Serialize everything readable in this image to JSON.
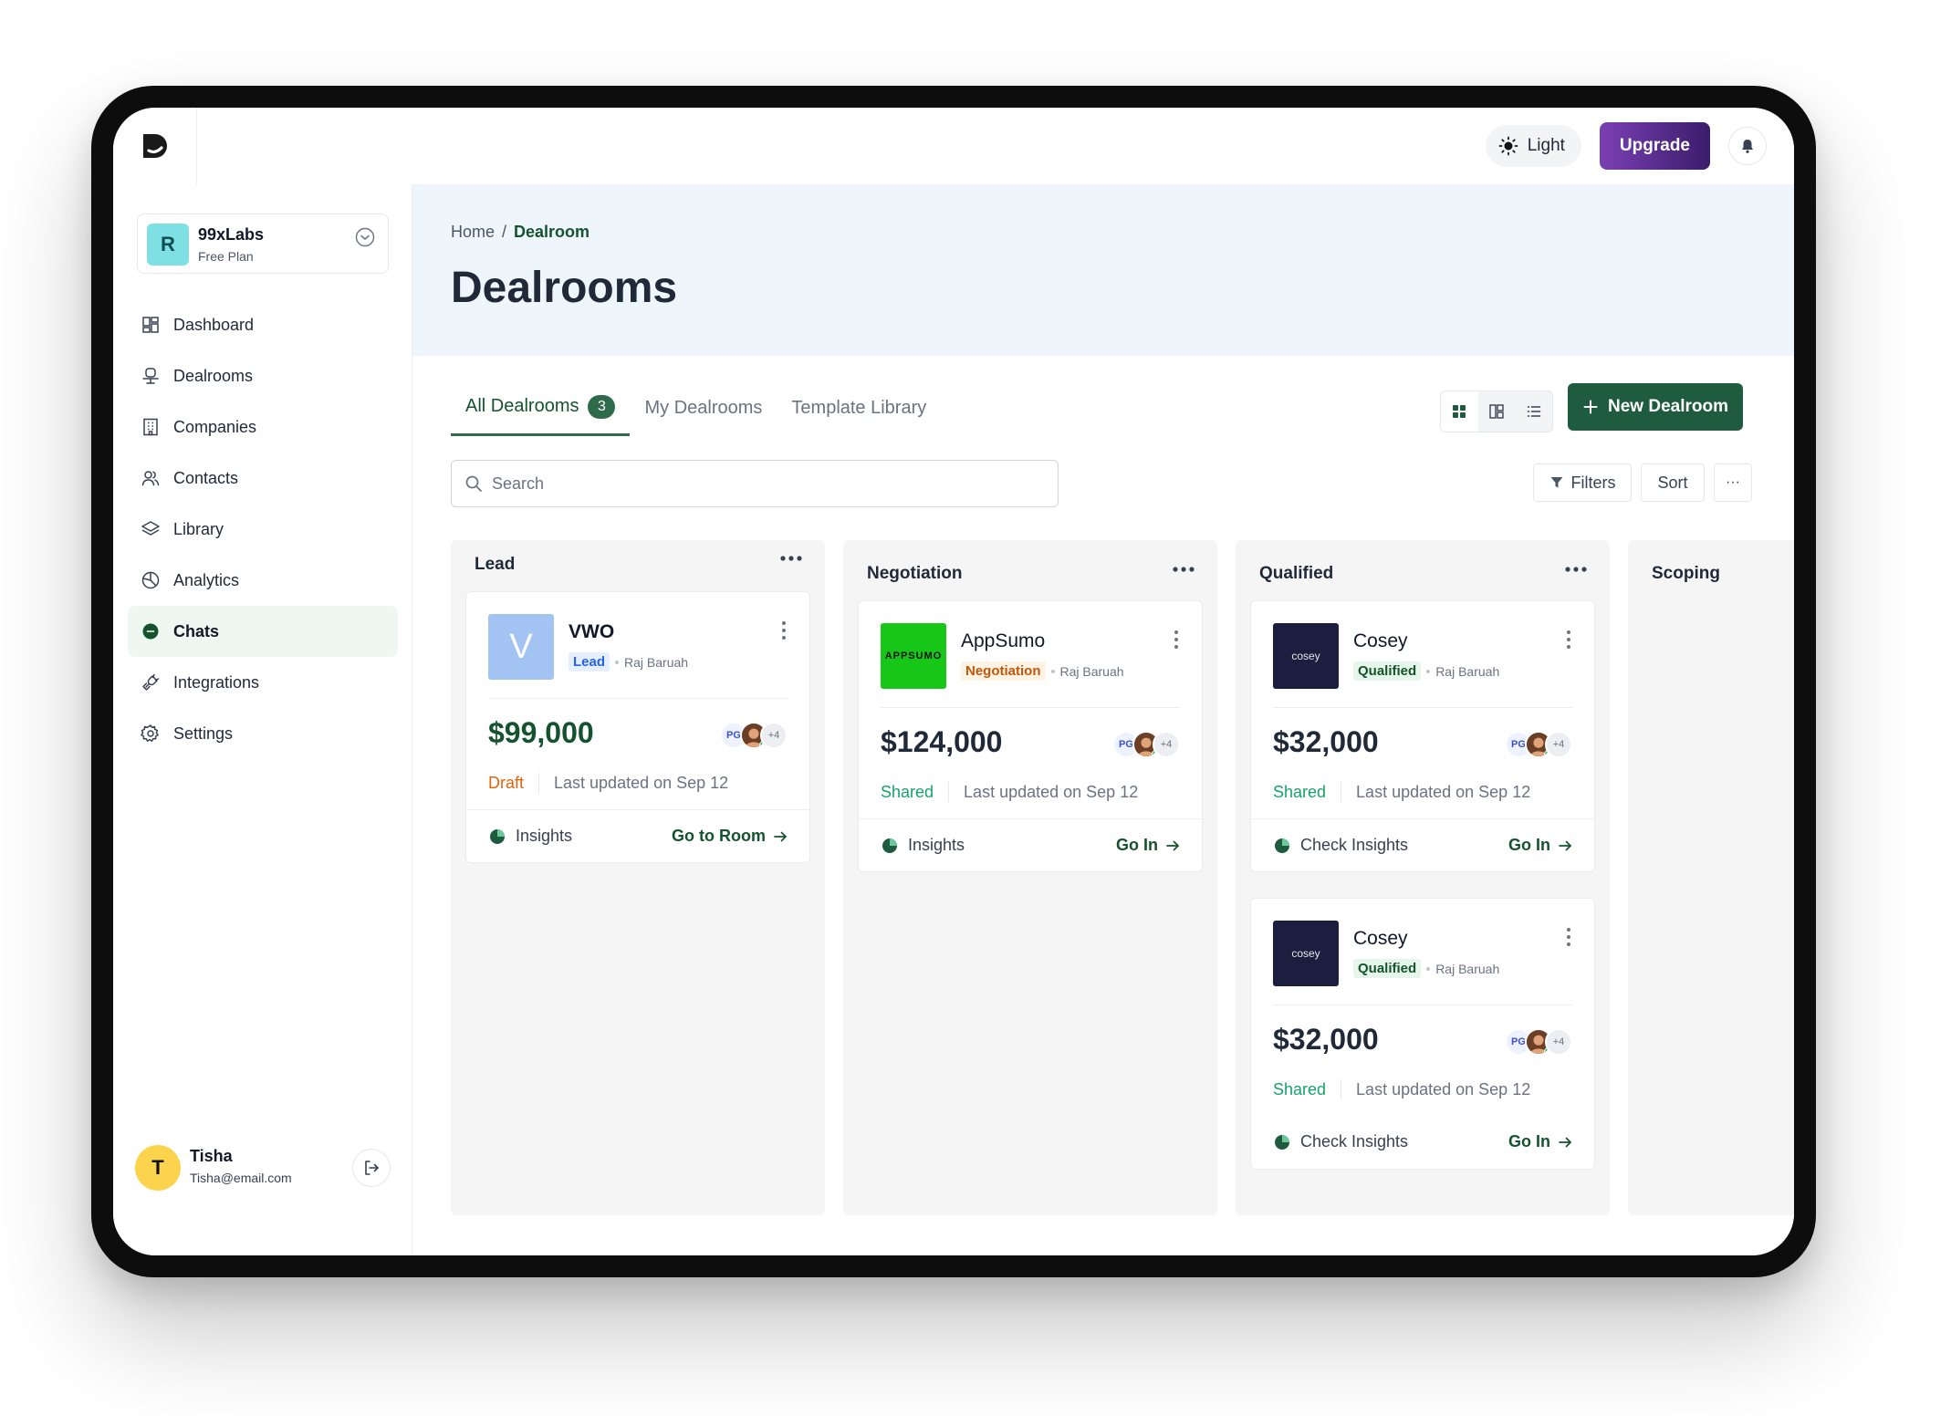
{
  "topbar": {
    "theme_label": "Light",
    "upgrade_label": "Upgrade"
  },
  "org": {
    "avatar_letter": "R",
    "name": "99xLabs",
    "plan": "Free Plan"
  },
  "nav": {
    "items": [
      {
        "label": "Dashboard",
        "icon": "dashboard-icon"
      },
      {
        "label": "Dealrooms",
        "icon": "dealroom-icon"
      },
      {
        "label": "Companies",
        "icon": "building-icon"
      },
      {
        "label": "Contacts",
        "icon": "users-icon"
      },
      {
        "label": "Library",
        "icon": "layers-icon"
      },
      {
        "label": "Analytics",
        "icon": "pie-chart-icon"
      },
      {
        "label": "Chats",
        "icon": "chat-icon",
        "active": true
      },
      {
        "label": "Integrations",
        "icon": "plug-icon"
      },
      {
        "label": "Settings",
        "icon": "gear-icon"
      }
    ]
  },
  "user": {
    "avatar_letter": "T",
    "name": "Tisha",
    "email": "Tisha@email.com"
  },
  "breadcrumb": {
    "home": "Home",
    "separator": "/",
    "current": "Dealroom"
  },
  "page_title": "Dealrooms",
  "tabs": [
    {
      "label": "All Dealrooms",
      "count": "3",
      "active": true
    },
    {
      "label": "My Dealrooms"
    },
    {
      "label": "Template Library"
    }
  ],
  "new_button_label": "New Dealroom",
  "search": {
    "placeholder": "Search"
  },
  "toolbar": {
    "filters_label": "Filters",
    "sort_label": "Sort",
    "more_label": "···"
  },
  "colors": {
    "brand_green": "#1f5c3f",
    "draft_orange": "#e0650a",
    "shared_green": "#16a36a",
    "lead_blue": "#2563eb",
    "qualified_green": "#14532d",
    "negotiation_orange": "#c2570c"
  },
  "columns": [
    {
      "title": "Lead",
      "cards": [
        {
          "name": "VWO",
          "logo_text": "V",
          "stage": "Lead",
          "owner": "Raj Baruah",
          "value": "$99,000",
          "avatar_initials": "PG",
          "avatar_more": "+4",
          "status": "Draft",
          "updated": "Last updated on Sep 12",
          "insights_label": "Insights",
          "action_label": "Go to Room"
        }
      ]
    },
    {
      "title": "Negotiation",
      "cards": [
        {
          "name": "AppSumo",
          "logo_text": "APPSUMO",
          "stage": "Negotiation",
          "owner": "Raj Baruah",
          "value": "$124,000",
          "avatar_initials": "PG",
          "avatar_more": "+4",
          "status": "Shared",
          "updated": "Last updated on Sep 12",
          "insights_label": "Insights",
          "action_label": "Go In"
        }
      ]
    },
    {
      "title": "Qualified",
      "cards": [
        {
          "name": "Cosey",
          "logo_text": "cosey",
          "stage": "Qualified",
          "owner": "Raj Baruah",
          "value": "$32,000",
          "avatar_initials": "PG",
          "avatar_more": "+4",
          "status": "Shared",
          "updated": "Last updated on Sep 12",
          "insights_label": "Check Insights",
          "action_label": "Go In"
        },
        {
          "name": "Cosey",
          "logo_text": "cosey",
          "stage": "Qualified",
          "owner": "Raj Baruah",
          "value": "$32,000",
          "avatar_initials": "PG",
          "avatar_more": "+4",
          "status": "Shared",
          "updated": "Last updated on Sep 12",
          "insights_label": "Check Insights",
          "action_label": "Go In"
        }
      ]
    },
    {
      "title": "Scoping",
      "cards": []
    }
  ]
}
